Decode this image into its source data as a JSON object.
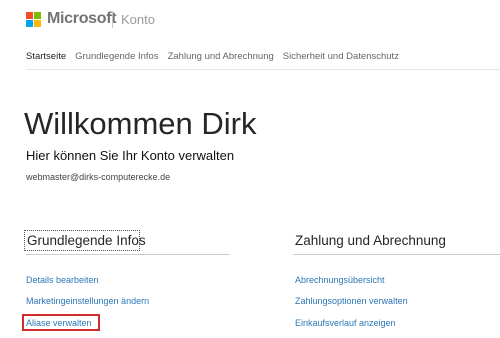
{
  "header": {
    "brand": "Microsoft",
    "product": "Konto",
    "logo_colors": [
      "#f25022",
      "#7fba00",
      "#00a4ef",
      "#ffb900"
    ]
  },
  "nav": {
    "items": [
      {
        "label": "Startseite",
        "active": true
      },
      {
        "label": "Grundlegende Infos",
        "active": false
      },
      {
        "label": "Zahlung und Abrechnung",
        "active": false
      },
      {
        "label": "Sicherheit und Datenschutz",
        "active": false
      }
    ]
  },
  "welcome": {
    "title": "Willkommen Dirk",
    "subtitle": "Hier können Sie Ihr Konto verwalten",
    "email": "webmaster@dirks-computerecke.de"
  },
  "sections": [
    {
      "title": "Grundlegende Infos",
      "links": [
        "Details bearbeiten",
        "Marketingeinstellungen ändern",
        "Aliase verwalten"
      ]
    },
    {
      "title": "Zahlung und Abrechnung",
      "links": [
        "Abrechnungsübersicht",
        "Zahlungsoptionen verwalten",
        "Einkaufsverlauf anzeigen"
      ]
    }
  ],
  "colors": {
    "link": "#2b78b9",
    "highlight": "#d12b2b"
  }
}
